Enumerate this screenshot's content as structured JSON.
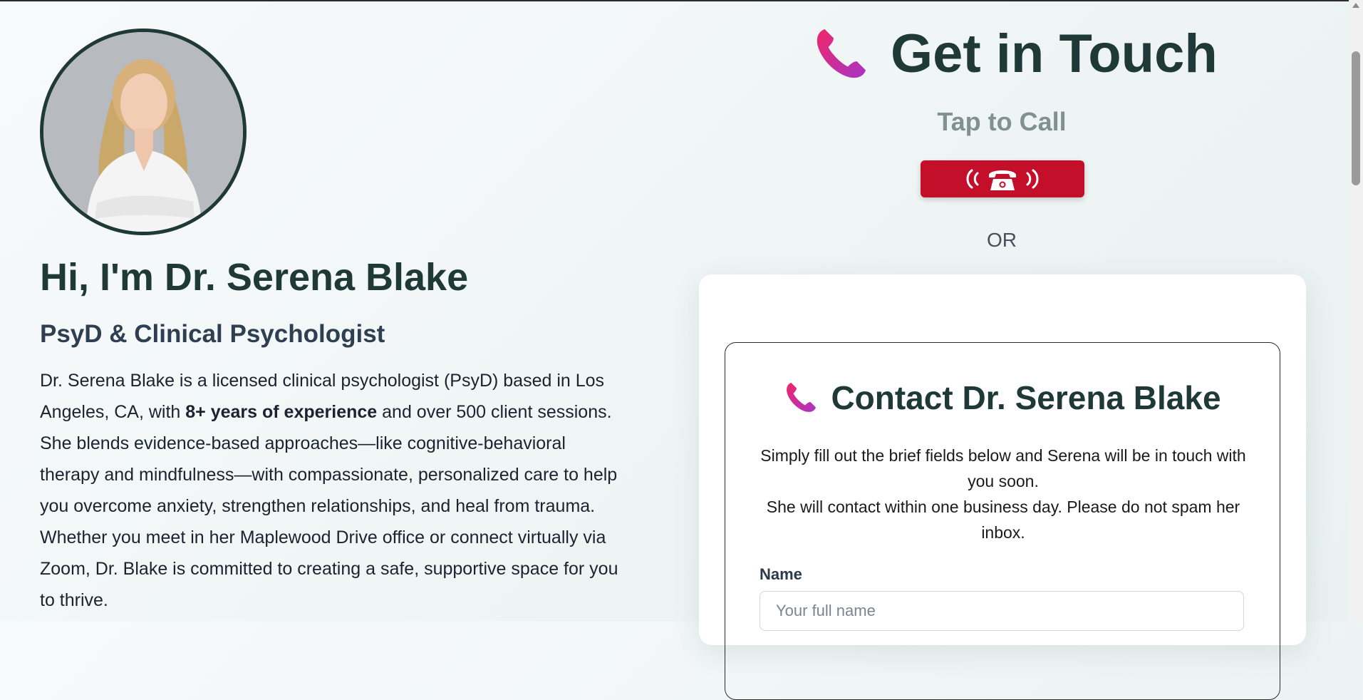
{
  "profile": {
    "avatar_alt": "Portrait of Dr. Serena Blake",
    "greeting": "Hi, I'm Dr. Serena Blake",
    "credentials": "PsyD & Clinical Psychologist",
    "bio_part1": "Dr. Serena Blake is a licensed clinical psychologist (PsyD) based in Los Angeles, CA, with ",
    "bio_bold": "8+ years of experience",
    "bio_part2": " and over 500 client sessions. She blends evidence-based approaches—like cognitive-behavioral therapy and mindfulness—with compassionate, personalized care to help you overcome anxiety, strengthen relationships, and heal from trauma. Whether you meet in her Maplewood Drive office or connect virtually via Zoom, Dr. Blake is committed to creating a safe, supportive space for you to thrive."
  },
  "contact": {
    "heading": "Get in Touch",
    "tap_label": "Tap to Call",
    "or_label": "OR",
    "form_title": "Contact Dr. Serena Blake",
    "description_line1": "Simply fill out the brief fields below and Serena will be in touch with you soon.",
    "description_line2": "She will contact within one business day. Please do not spam her inbox.",
    "name_label": "Name",
    "name_placeholder": "Your full name",
    "name_value": ""
  },
  "icons": {
    "heading_icon": "telephone-receiver-icon",
    "call_button_icon": "ringing-phone-icon",
    "form_icon": "telephone-receiver-icon"
  },
  "colors": {
    "primary": "#1f3a36",
    "call_button": "#c40f2b",
    "phone_icon_gradient": [
      "#e5296b",
      "#b02eb0"
    ],
    "muted": "#7f928f"
  }
}
